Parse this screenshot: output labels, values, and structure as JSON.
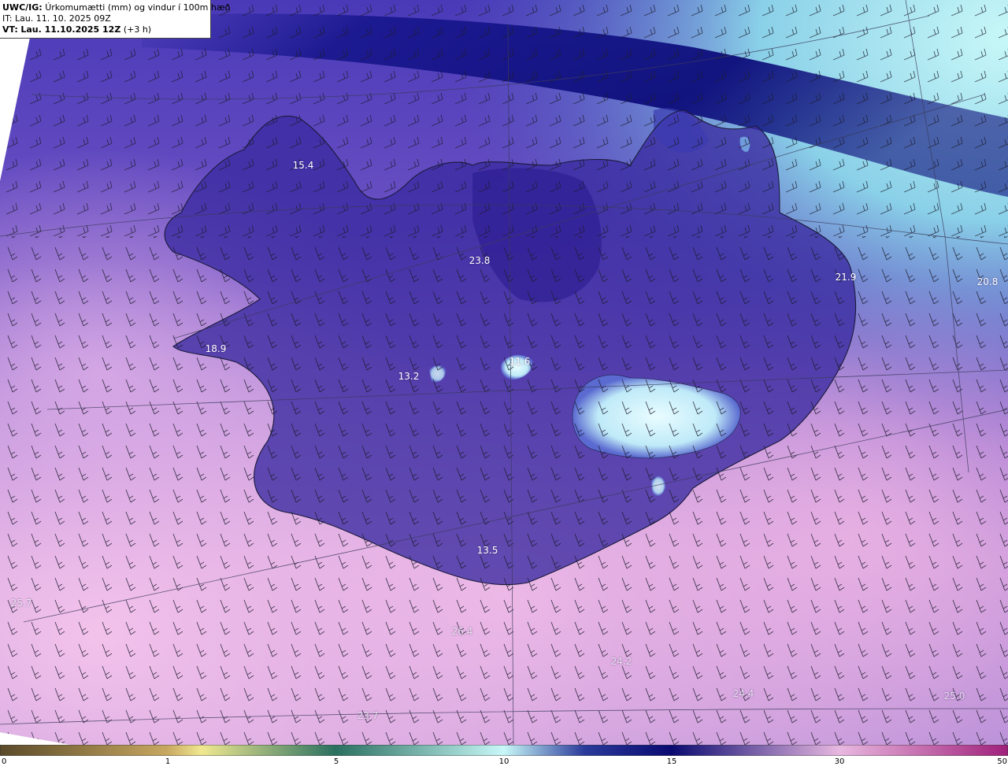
{
  "header": {
    "code": "UWC/IG:",
    "title": "Úrkomumætti (mm) og vindur í 100m hæð",
    "init_prefix": "IT:",
    "init_time": "Lau. 11. 10. 2025 09Z",
    "valid_prefix": "VT:",
    "valid_time": "Lau. 11.10.2025 12Z",
    "lead": "(+3 h)"
  },
  "map_values": [
    {
      "id": "v1",
      "text": "15.4"
    },
    {
      "id": "v2",
      "text": "23.8"
    },
    {
      "id": "v3",
      "text": "21.9"
    },
    {
      "id": "v4",
      "text": "20.8"
    },
    {
      "id": "v5",
      "text": "18.9"
    },
    {
      "id": "v6",
      "text": "13.2"
    },
    {
      "id": "v7",
      "text": "11.6"
    },
    {
      "id": "v8",
      "text": "13.5"
    },
    {
      "id": "v9",
      "text": "25.7"
    },
    {
      "id": "v10",
      "text": "26.4"
    },
    {
      "id": "v11",
      "text": "24.2"
    },
    {
      "id": "v12",
      "text": "24.4"
    },
    {
      "id": "v13",
      "text": "25.0"
    },
    {
      "id": "v14",
      "text": "23.7"
    }
  ],
  "colorbar": {
    "ticks": [
      "0",
      "1",
      "5",
      "10",
      "15",
      "30",
      "50"
    ],
    "stops": [
      "#5a4a2a",
      "#c8a860",
      "#f0e890",
      "#2a7060",
      "#c8f8f8",
      "#2a3a9a",
      "#0a0a70",
      "#e8b8e0",
      "#a0207a"
    ]
  },
  "colors": {
    "ocean_north": "#b8f0f0",
    "ocean_band": "#2a2aa0",
    "land_dark": "#3a2a9a",
    "ocean_south": "#f0b8e6",
    "mid": "#9070c8",
    "coast": "#1a1a3a",
    "ice": "#d8f8ff"
  }
}
